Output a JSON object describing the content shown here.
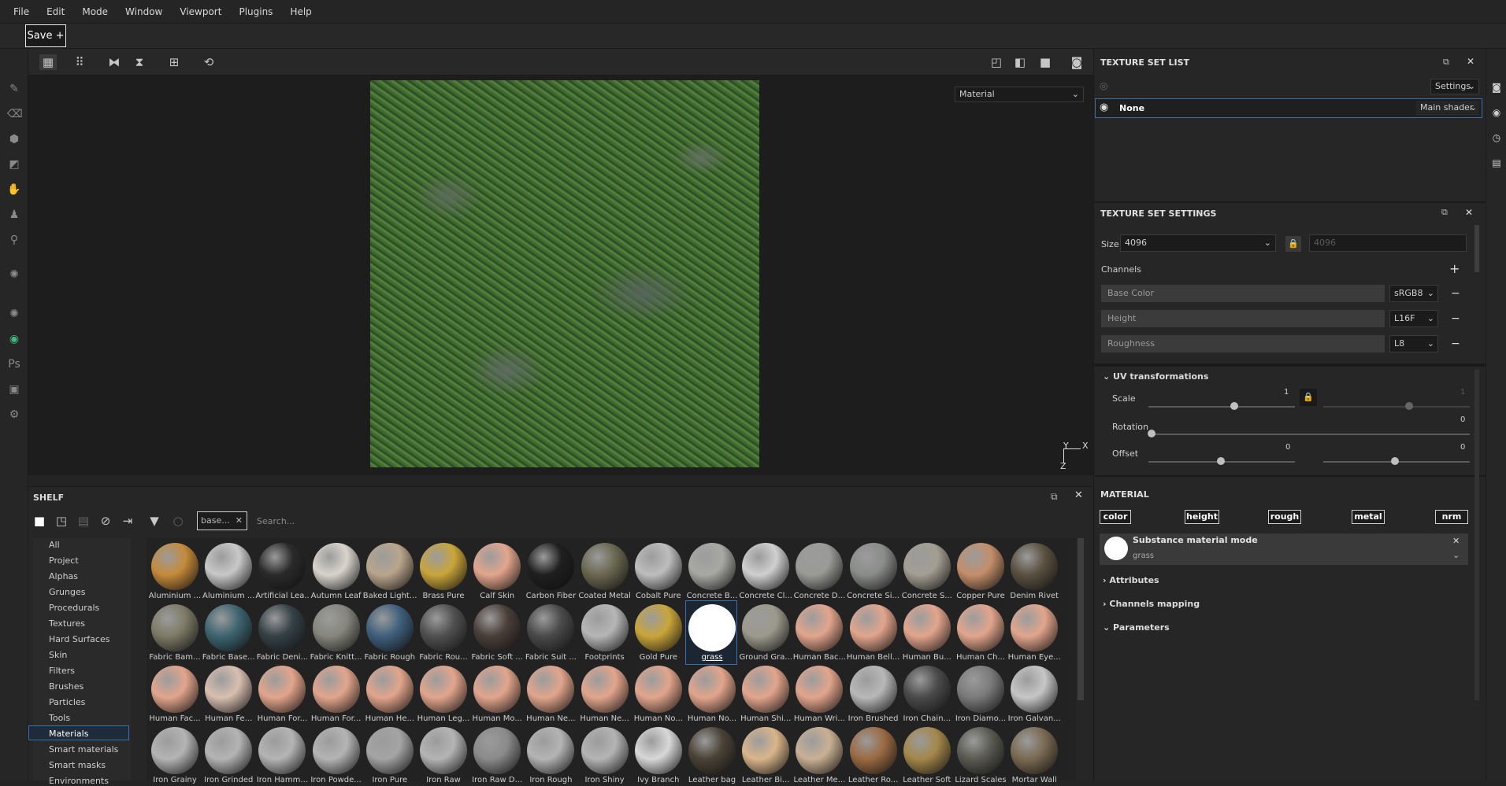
{
  "menu": [
    "File",
    "Edit",
    "Mode",
    "Window",
    "Viewport",
    "Plugins",
    "Help"
  ],
  "save_label": "Save +",
  "viewport": {
    "material_mode": "Material",
    "axis_y": "Y",
    "axis_x": "X",
    "axis_z": "Z"
  },
  "shelf": {
    "title": "SHELF",
    "filter_chip": "base...",
    "search_placeholder": "Search...",
    "categories": [
      "All",
      "Project",
      "Alphas",
      "Grunges",
      "Procedurals",
      "Textures",
      "Hard Surfaces",
      "Skin",
      "Filters",
      "Brushes",
      "Particles",
      "Tools",
      "Materials",
      "Smart materials",
      "Smart masks",
      "Environments"
    ],
    "selected_category": "Materials",
    "rows": [
      [
        "Aluminium ...",
        "Aluminium ...",
        "Artificial Lea...",
        "Autumn Leaf",
        "Baked Light...",
        "Brass Pure",
        "Calf Skin",
        "Carbon Fiber",
        "Coated Metal",
        "Cobalt Pure",
        "Concrete B...",
        "Concrete Cl...",
        "Concrete D...",
        "Concrete Si...",
        "Concrete S...",
        "Copper Pure",
        "Denim Rivet"
      ],
      [
        "Fabric Bam...",
        "Fabric Base...",
        "Fabric Deni...",
        "Fabric Knitt...",
        "Fabric Rough",
        "Fabric Rou...",
        "Fabric Soft ...",
        "Fabric Suit ...",
        "Footprints",
        "Gold Pure",
        "grass",
        "Ground Gra...",
        "Human Bac...",
        "Human Bell...",
        "Human Bu...",
        "Human Ch...",
        "Human Eye..."
      ],
      [
        "Human Fac...",
        "Human Fe...",
        "Human For...",
        "Human For...",
        "Human He...",
        "Human Leg...",
        "Human Mo...",
        "Human Ne...",
        "Human Ne...",
        "Human No...",
        "Human No...",
        "Human Shi...",
        "Human Wri...",
        "Iron Brushed",
        "Iron Chain...",
        "Iron Diamo...",
        "Iron Galvan..."
      ],
      [
        "Iron Grainy",
        "Iron Grinded",
        "Iron Hamm...",
        "Iron Powde...",
        "Iron Pure",
        "Iron Raw",
        "Iron Raw D...",
        "Iron Rough",
        "Iron Shiny",
        "Ivy Branch",
        "Leather bag",
        "Leather Bi...",
        "Leather Me...",
        "Leather Ro...",
        "Leather Soft",
        "Lizard Scales",
        "Mortar Wall"
      ]
    ],
    "selected_material": "grass"
  },
  "texture_set_list": {
    "title": "TEXTURE SET LIST",
    "settings_label": "Settings",
    "row_name": "None",
    "shader": "Main shader"
  },
  "texture_set_settings": {
    "title": "TEXTURE SET SETTINGS",
    "size_label": "Size",
    "size_value": "4096",
    "size_locked_value": "4096",
    "channels_label": "Channels",
    "channels": [
      {
        "name": "Base Color",
        "format": "sRGB8"
      },
      {
        "name": "Height",
        "format": "L16F"
      },
      {
        "name": "Roughness",
        "format": "L8"
      }
    ]
  },
  "uv": {
    "title": "UV transformations",
    "scale_label": "Scale",
    "scale_value": "1",
    "scale_value2": "1",
    "rotation_label": "Rotation",
    "rotation_value": "0",
    "offset_label": "Offset",
    "offset_value_u": "0",
    "offset_value_v": "0"
  },
  "material": {
    "title": "MATERIAL",
    "chips": [
      "color",
      "height",
      "rough",
      "metal",
      "nrm"
    ],
    "mode_title": "Substance material mode",
    "mode_value": "grass",
    "sections": [
      "Attributes",
      "Channels mapping",
      "Parameters"
    ]
  }
}
